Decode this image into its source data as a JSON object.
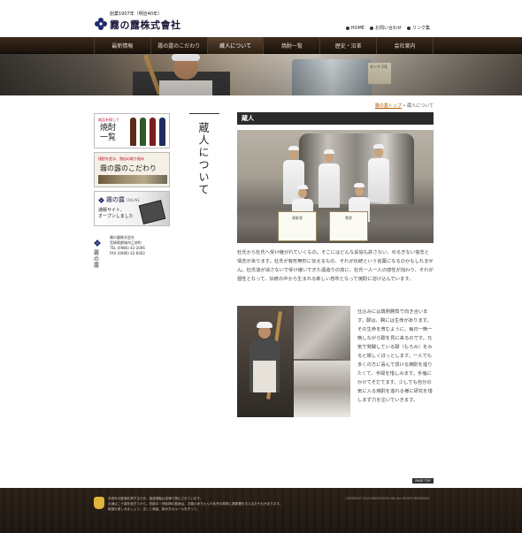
{
  "header": {
    "tagline": "創業1907年（明治40年）",
    "company_name": "霧の露株式會社",
    "util_links": [
      {
        "label": "HOME"
      },
      {
        "label": "お問い合わせ"
      },
      {
        "label": "リンク集"
      }
    ]
  },
  "gnav": {
    "items": [
      {
        "label": "最新情報",
        "active": false
      },
      {
        "label": "霧の露のこだわり",
        "active": false
      },
      {
        "label": "蔵人について",
        "active": true
      },
      {
        "label": "焼酎一覧",
        "active": false
      },
      {
        "label": "歴史・沿革",
        "active": false
      },
      {
        "label": "会社案内",
        "active": false
      }
    ]
  },
  "hero": {
    "sign_text": "タンク\n2号"
  },
  "breadcrumb": {
    "home": "霧の露トップ",
    "separator": "»",
    "current": "蔵人について"
  },
  "page_title_vertical": "蔵人について",
  "sidebar": {
    "banner1": {
      "small": "商品を探して",
      "big_line1": "焼酎",
      "big_line2": "一覧"
    },
    "banner2": {
      "small": "焼酎を造る、独自の取り組み",
      "big": "霧の露のこだわり"
    },
    "banner3": {
      "logo": "霧の露",
      "online": "ONLINE",
      "text_line1": "通販サイト、",
      "text_line2": "オープンしました"
    },
    "company": {
      "mark_text": "霧の露",
      "name": "霧の露株式会社",
      "address": "宮崎県都城市乙房町",
      "tel": "TEL (0986) 42-2006",
      "fax": "FAX (0986) 42-6002"
    }
  },
  "main": {
    "section_title": "蔵人",
    "cert_labels": [
      "表彰状",
      "賞状"
    ],
    "paragraph1": "杜氏から杜氏へ受け継がれていくもの。そこにはどんな妥協も許さない、ゆるぎない信念と情念があります。杜氏が有形無形に伝えるもの、それが伝統という言葉になるのかもしれません。杜氏達が消さないで受け継いできた酒造りの技に、杜氏一人一人の感性が加わり、それが個性となって、伝統の中から生まれる新しい息吹となって焼酎に溶け込んでいます。",
    "paragraph2": "仕込みには真剣勝負で向き合います。醪は、麹には生命があります。その生命を育むように、毎日一晩一晩しながら醪を見に来るのです。元気で発酵している醪（もろみ）をみると嬉しくほっとします。一人でも多くの方に喜んで頂ける焼酎を造りたくて、手間を惜しみます。手塩にかけてそだてます。少しでも自分の気に入る焼酎を造れる様に研究を惜しまず力を注いでいきます。"
  },
  "page_top_label": "PAGE TOP",
  "footer": {
    "notice_line1": "未成年の飲酒を禁ずるため、飲酒運転は法律で禁止されています。",
    "notice_line2": "お酒は二十歳を過ぎてから。妊娠中・授乳期の飲酒は、お腹の赤ちゃんや乳児の発育に悪影響を与えるおそれがあります。",
    "notice_line3": "飲酒を楽しみましょう。正しく適量、飲み方のルールを守って。",
    "copyright": "COPYRIGHT 2010 KIRINOTSUYU INC.ALL RIGHTS RESERVED."
  },
  "colors": {
    "nav_bg": "#2b1e13",
    "section_header_bg": "#2b2b2b",
    "breadcrumb_link": "#b35a00",
    "footer_bg": "#1d160f"
  }
}
